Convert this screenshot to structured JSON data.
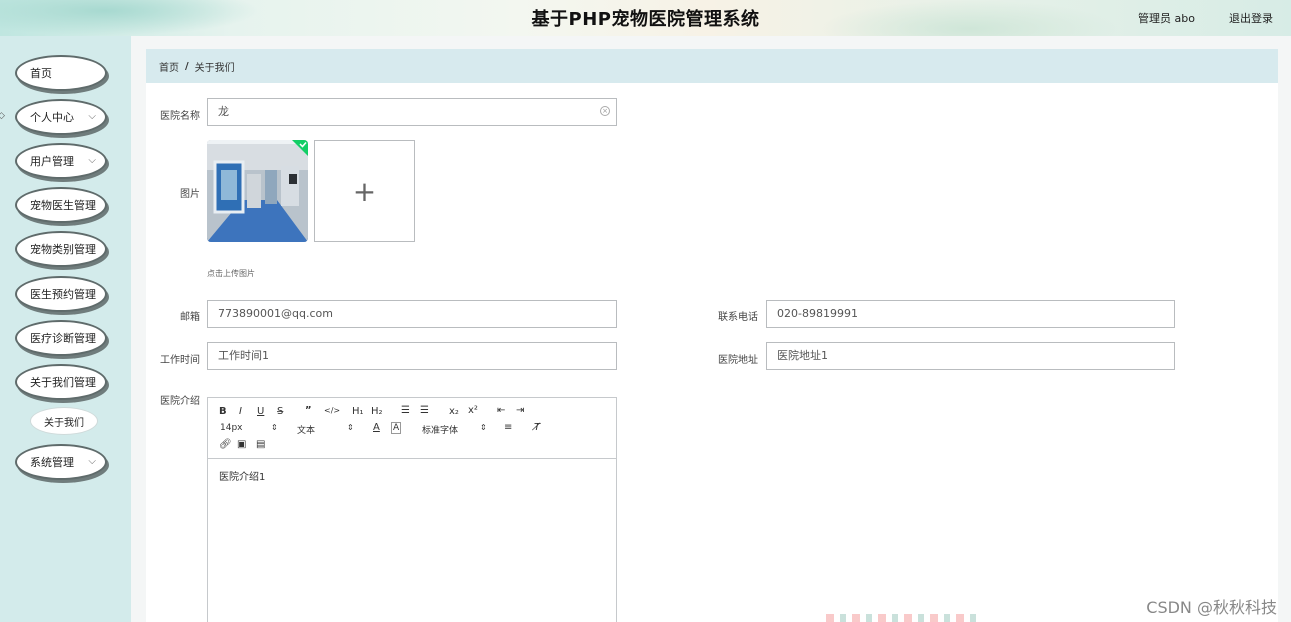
{
  "header": {
    "title": "基于PHP宠物医院管理系统",
    "user_text": "管理员 abo",
    "logout_label": "退出登录"
  },
  "sidebar": {
    "items": [
      {
        "label": "首页",
        "has_arrow": false
      },
      {
        "label": "个人中心",
        "has_arrow": true
      },
      {
        "label": "用户管理",
        "has_arrow": true
      },
      {
        "label": "宠物医生管理",
        "has_arrow": false
      },
      {
        "label": "宠物类别管理",
        "has_arrow": false
      },
      {
        "label": "医生预约管理",
        "has_arrow": false
      },
      {
        "label": "医疗诊断管理",
        "has_arrow": false
      },
      {
        "label": "关于我们管理",
        "has_arrow": false
      },
      {
        "label": "系统管理",
        "has_arrow": true
      }
    ],
    "subitem": {
      "label": "关于我们"
    },
    "chevron": "⌵"
  },
  "breadcrumb": {
    "home": "首页",
    "separator": "/",
    "current": "关于我们"
  },
  "form": {
    "name_label": "医院名称",
    "name_value": "龙",
    "image_label": "图片",
    "upload_tip": "点击上传图片",
    "email_label": "邮箱",
    "email_value": "773890001@qq.com",
    "phone_label": "联系电话",
    "phone_value": "020-89819991",
    "worktime_label": "工作时间",
    "worktime_value": "工作时间1",
    "address_label": "医院地址",
    "address_value": "医院地址1",
    "intro_label": "医院介绍",
    "intro_content": "医院介绍1"
  },
  "editor": {
    "font_size": "14px",
    "text_style": "文本",
    "font_family": "标准字体"
  },
  "watermark": "CSDN @秋秋科技",
  "icons": {
    "upload_plus": "+",
    "clear": "×"
  }
}
